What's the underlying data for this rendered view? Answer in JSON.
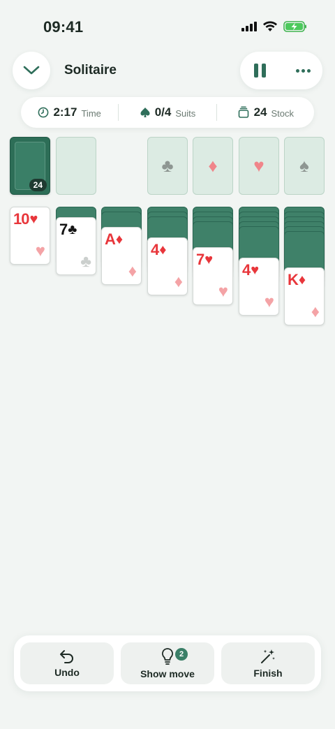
{
  "status_bar": {
    "time": "09:41"
  },
  "header": {
    "title": "Solitaire"
  },
  "stats": {
    "time_value": "2:17",
    "time_label": "Time",
    "suits_value": "0/4",
    "suits_label": "Suits",
    "stock_value": "24",
    "stock_label": "Stock"
  },
  "board": {
    "stock_count": "24",
    "foundations": [
      {
        "suit": "clubs",
        "symbol": "♣"
      },
      {
        "suit": "diamonds",
        "symbol": "♦"
      },
      {
        "suit": "hearts",
        "symbol": "♥"
      },
      {
        "suit": "spades",
        "symbol": "♠"
      }
    ],
    "tableau": [
      {
        "facedown": 0,
        "rank": "10",
        "symbol": "♥",
        "color": "red"
      },
      {
        "facedown": 1,
        "rank": "7",
        "symbol": "♣",
        "color": "black"
      },
      {
        "facedown": 2,
        "rank": "A",
        "symbol": "♦",
        "color": "red"
      },
      {
        "facedown": 3,
        "rank": "4",
        "symbol": "♦",
        "color": "red"
      },
      {
        "facedown": 4,
        "rank": "7",
        "symbol": "♥",
        "color": "red"
      },
      {
        "facedown": 5,
        "rank": "4",
        "symbol": "♥",
        "color": "red"
      },
      {
        "facedown": 6,
        "rank": "K",
        "symbol": "♦",
        "color": "red"
      }
    ]
  },
  "toolbar": {
    "undo_label": "Undo",
    "show_move_label": "Show move",
    "show_move_badge": "2",
    "finish_label": "Finish"
  },
  "colors": {
    "accent": "#2f6e5a",
    "red_suit": "#e8363b",
    "card_back": "#3f8169"
  }
}
